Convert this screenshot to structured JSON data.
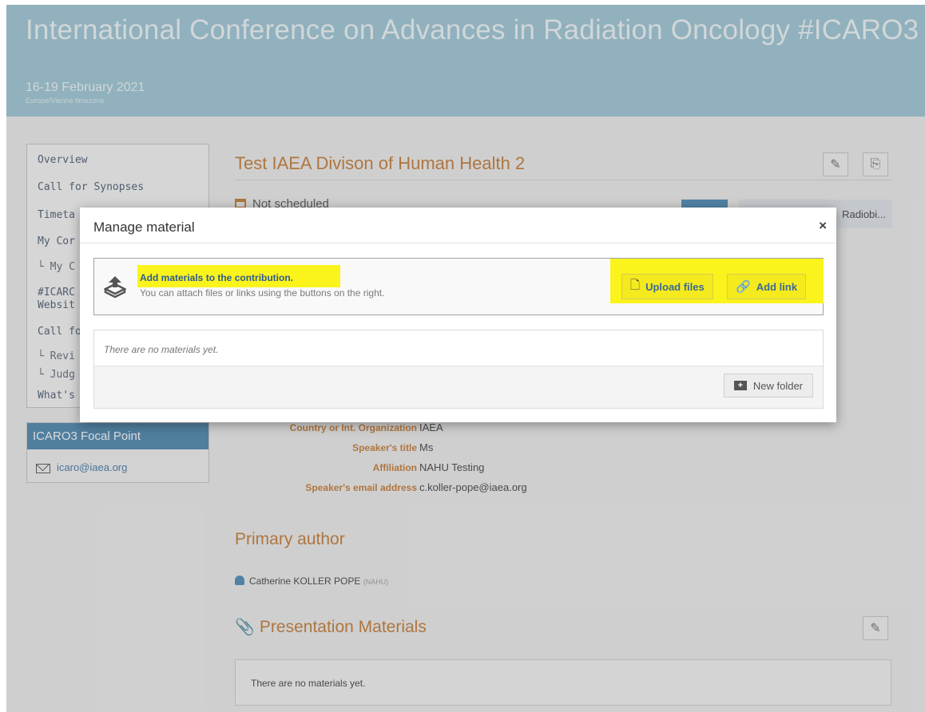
{
  "conference": {
    "title": "International Conference on Advances in Radiation Oncology #ICARO3",
    "date": "16-19 February 2021",
    "timezone": "Europe/Vienna timezone"
  },
  "sidebar": {
    "items": [
      {
        "label": "Overview"
      },
      {
        "label": "Call for Synopses"
      },
      {
        "label": "Timeta"
      },
      {
        "label": "My Cor"
      },
      {
        "label": "└ My C"
      },
      {
        "label": "#ICARC"
      },
      {
        "label": "Websit"
      },
      {
        "label": "Call for"
      },
      {
        "label": "└ Revi"
      },
      {
        "label": "└ Judg"
      },
      {
        "label": "What's"
      }
    ]
  },
  "focal_point": {
    "heading": "ICARO3 Focal Point",
    "email": "icaro@iaea.org"
  },
  "contribution": {
    "title": "Test IAEA Divison of Human Health 2",
    "schedule_status": "Not scheduled",
    "track_chip": "Radiobi..."
  },
  "details": [
    {
      "key": "Country or Int. Organization",
      "value": "IAEA"
    },
    {
      "key": "Speaker's title",
      "value": "Ms"
    },
    {
      "key": "Affiliation",
      "value": "NAHU Testing"
    },
    {
      "key": "Speaker's email address",
      "value": "c.koller-pope@iaea.org"
    }
  ],
  "primary_author": {
    "heading": "Primary author",
    "name": "Catherine KOLLER POPE",
    "affiliation": "(NAHU)"
  },
  "presentation_materials": {
    "heading": "Presentation Materials",
    "empty_text": "There are no materials yet."
  },
  "modal": {
    "title": "Manage material",
    "close": "×",
    "add_title": "Add materials to the contribution.",
    "add_subtitle": "You can attach files or links using the buttons on the right.",
    "upload_label": "Upload files",
    "link_label": "Add link",
    "empty_text": "There are no materials yet.",
    "new_folder_label": "New folder"
  },
  "icons": {
    "edit": "✎",
    "pdf": "⎘",
    "file": "🗋",
    "link": "🔗",
    "clip": "📎",
    "folder_plus": "+"
  },
  "colors": {
    "header_bg": "#a8cedc",
    "accent_orange": "#cc8a4a",
    "focal_blue": "#5e93b8",
    "highlight_yellow": "#fbf31c"
  }
}
